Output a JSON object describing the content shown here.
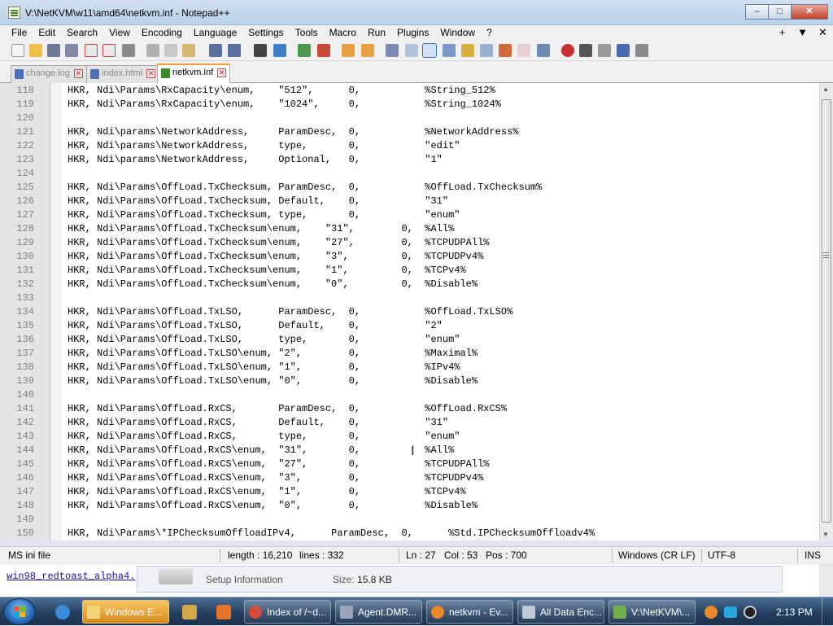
{
  "window": {
    "title": "V:\\NetKVM\\w11\\amd64\\netkvm.inf - Notepad++",
    "controls": {
      "minimize": "–",
      "maximize": "□",
      "close": "✕"
    }
  },
  "menu": {
    "items": [
      "File",
      "Edit",
      "Search",
      "View",
      "Encoding",
      "Language",
      "Settings",
      "Tools",
      "Macro",
      "Run",
      "Plugins",
      "Window",
      "?"
    ],
    "right": [
      "+",
      "▼",
      "✕"
    ]
  },
  "tabs": [
    {
      "label": "change.log",
      "active": false
    },
    {
      "label": "index.html",
      "active": false
    },
    {
      "label": "netkvm.inf",
      "active": true
    }
  ],
  "editor": {
    "lines": [
      {
        "n": "118",
        "text": "HKR, Ndi\\Params\\RxCapacity\\enum,    \"512\",      0,           %String_512%"
      },
      {
        "n": "119",
        "text": "HKR, Ndi\\Params\\RxCapacity\\enum,    \"1024\",     0,           %String_1024%"
      },
      {
        "n": "120",
        "text": ""
      },
      {
        "n": "121",
        "text": "HKR, Ndi\\params\\NetworkAddress,     ParamDesc,  0,           %NetworkAddress%"
      },
      {
        "n": "122",
        "text": "HKR, Ndi\\params\\NetworkAddress,     type,       0,           \"edit\""
      },
      {
        "n": "123",
        "text": "HKR, Ndi\\params\\NetworkAddress,     Optional,   0,           \"1\""
      },
      {
        "n": "124",
        "text": ""
      },
      {
        "n": "125",
        "text": "HKR, Ndi\\Params\\OffLoad.TxChecksum, ParamDesc,  0,           %OffLoad.TxChecksum%"
      },
      {
        "n": "126",
        "text": "HKR, Ndi\\Params\\OffLoad.TxChecksum, Default,    0,           \"31\""
      },
      {
        "n": "127",
        "text": "HKR, Ndi\\Params\\OffLoad.TxChecksum, type,       0,           \"enum\""
      },
      {
        "n": "128",
        "text": "HKR, Ndi\\Params\\OffLoad.TxChecksum\\enum,    \"31\",        0,  %All%"
      },
      {
        "n": "129",
        "text": "HKR, Ndi\\Params\\OffLoad.TxChecksum\\enum,    \"27\",        0,  %TCPUDPAll%"
      },
      {
        "n": "130",
        "text": "HKR, Ndi\\Params\\OffLoad.TxChecksum\\enum,    \"3\",         0,  %TCPUDPv4%"
      },
      {
        "n": "131",
        "text": "HKR, Ndi\\Params\\OffLoad.TxChecksum\\enum,    \"1\",         0,  %TCPv4%"
      },
      {
        "n": "132",
        "text": "HKR, Ndi\\Params\\OffLoad.TxChecksum\\enum,    \"0\",         0,  %Disable%"
      },
      {
        "n": "133",
        "text": ""
      },
      {
        "n": "134",
        "text": "HKR, Ndi\\Params\\OffLoad.TxLSO,      ParamDesc,  0,           %OffLoad.TxLSO%"
      },
      {
        "n": "135",
        "text": "HKR, Ndi\\Params\\OffLoad.TxLSO,      Default,    0,           \"2\""
      },
      {
        "n": "136",
        "text": "HKR, Ndi\\Params\\OffLoad.TxLSO,      type,       0,           \"enum\""
      },
      {
        "n": "137",
        "text": "HKR, Ndi\\Params\\OffLoad.TxLSO\\enum, \"2\",        0,           %Maximal%"
      },
      {
        "n": "138",
        "text": "HKR, Ndi\\Params\\OffLoad.TxLSO\\enum, \"1\",        0,           %IPv4%"
      },
      {
        "n": "139",
        "text": "HKR, Ndi\\Params\\OffLoad.TxLSO\\enum, \"0\",        0,           %Disable%"
      },
      {
        "n": "140",
        "text": ""
      },
      {
        "n": "141",
        "text": "HKR, Ndi\\Params\\OffLoad.RxCS,       ParamDesc,  0,           %OffLoad.RxCS%"
      },
      {
        "n": "142",
        "text": "HKR, Ndi\\Params\\OffLoad.RxCS,       Default,    0,           \"31\""
      },
      {
        "n": "143",
        "text": "HKR, Ndi\\Params\\OffLoad.RxCS,       type,       0,           \"enum\""
      },
      {
        "n": "144",
        "text": "HKR, Ndi\\Params\\OffLoad.RxCS\\enum,  \"31\",       0,           %All%"
      },
      {
        "n": "145",
        "text": "HKR, Ndi\\Params\\OffLoad.RxCS\\enum,  \"27\",       0,           %TCPUDPAll%"
      },
      {
        "n": "146",
        "text": "HKR, Ndi\\Params\\OffLoad.RxCS\\enum,  \"3\",        0,           %TCPUDPv4%"
      },
      {
        "n": "147",
        "text": "HKR, Ndi\\Params\\OffLoad.RxCS\\enum,  \"1\",        0,           %TCPv4%"
      },
      {
        "n": "148",
        "text": "HKR, Ndi\\Params\\OffLoad.RxCS\\enum,  \"0\",        0,           %Disable%"
      },
      {
        "n": "149",
        "text": ""
      },
      {
        "n": "150",
        "text": "HKR, Ndi\\Params\\*IPChecksumOffloadIPv4,      ParamDesc,  0,      %Std.IPChecksumOffloadv4%"
      }
    ]
  },
  "status": {
    "filetype": "MS ini file",
    "length": "length : 16,210",
    "lines": "lines : 332",
    "ln": "Ln : 27",
    "col": "Col : 53",
    "pos": "Pos : 700",
    "eol": "Windows (CR LF)",
    "encoding": "UTF-8",
    "mode": "INS"
  },
  "background_window": {
    "link": "win98_redtoast_alpha4.",
    "setup_label": "Setup Information",
    "size_label": "Size:",
    "size_value": "15.8 KB"
  },
  "taskbar": {
    "buttons": [
      {
        "label": "Windows E...",
        "active": true,
        "color": "#e9b84a"
      },
      {
        "label": "Index of /~d...",
        "active": false,
        "color": "#d64a3a"
      },
      {
        "label": "Agent.DMR...",
        "active": false,
        "color": "#9aa6b8"
      },
      {
        "label": "netkvm - Ev...",
        "active": false,
        "color": "#e98a2a"
      },
      {
        "label": "All Data Enc...",
        "active": false,
        "color": "#c0c8d4"
      },
      {
        "label": "V:\\NetKVM\\...",
        "active": false,
        "color": "#6fae4a"
      }
    ],
    "clock": "2:13 PM"
  },
  "colors": {
    "titlebar": "#c4d9ee",
    "active_tab_accent": "#f8a030",
    "gutter": "#e4e4e4",
    "taskbar": "#24405f"
  }
}
